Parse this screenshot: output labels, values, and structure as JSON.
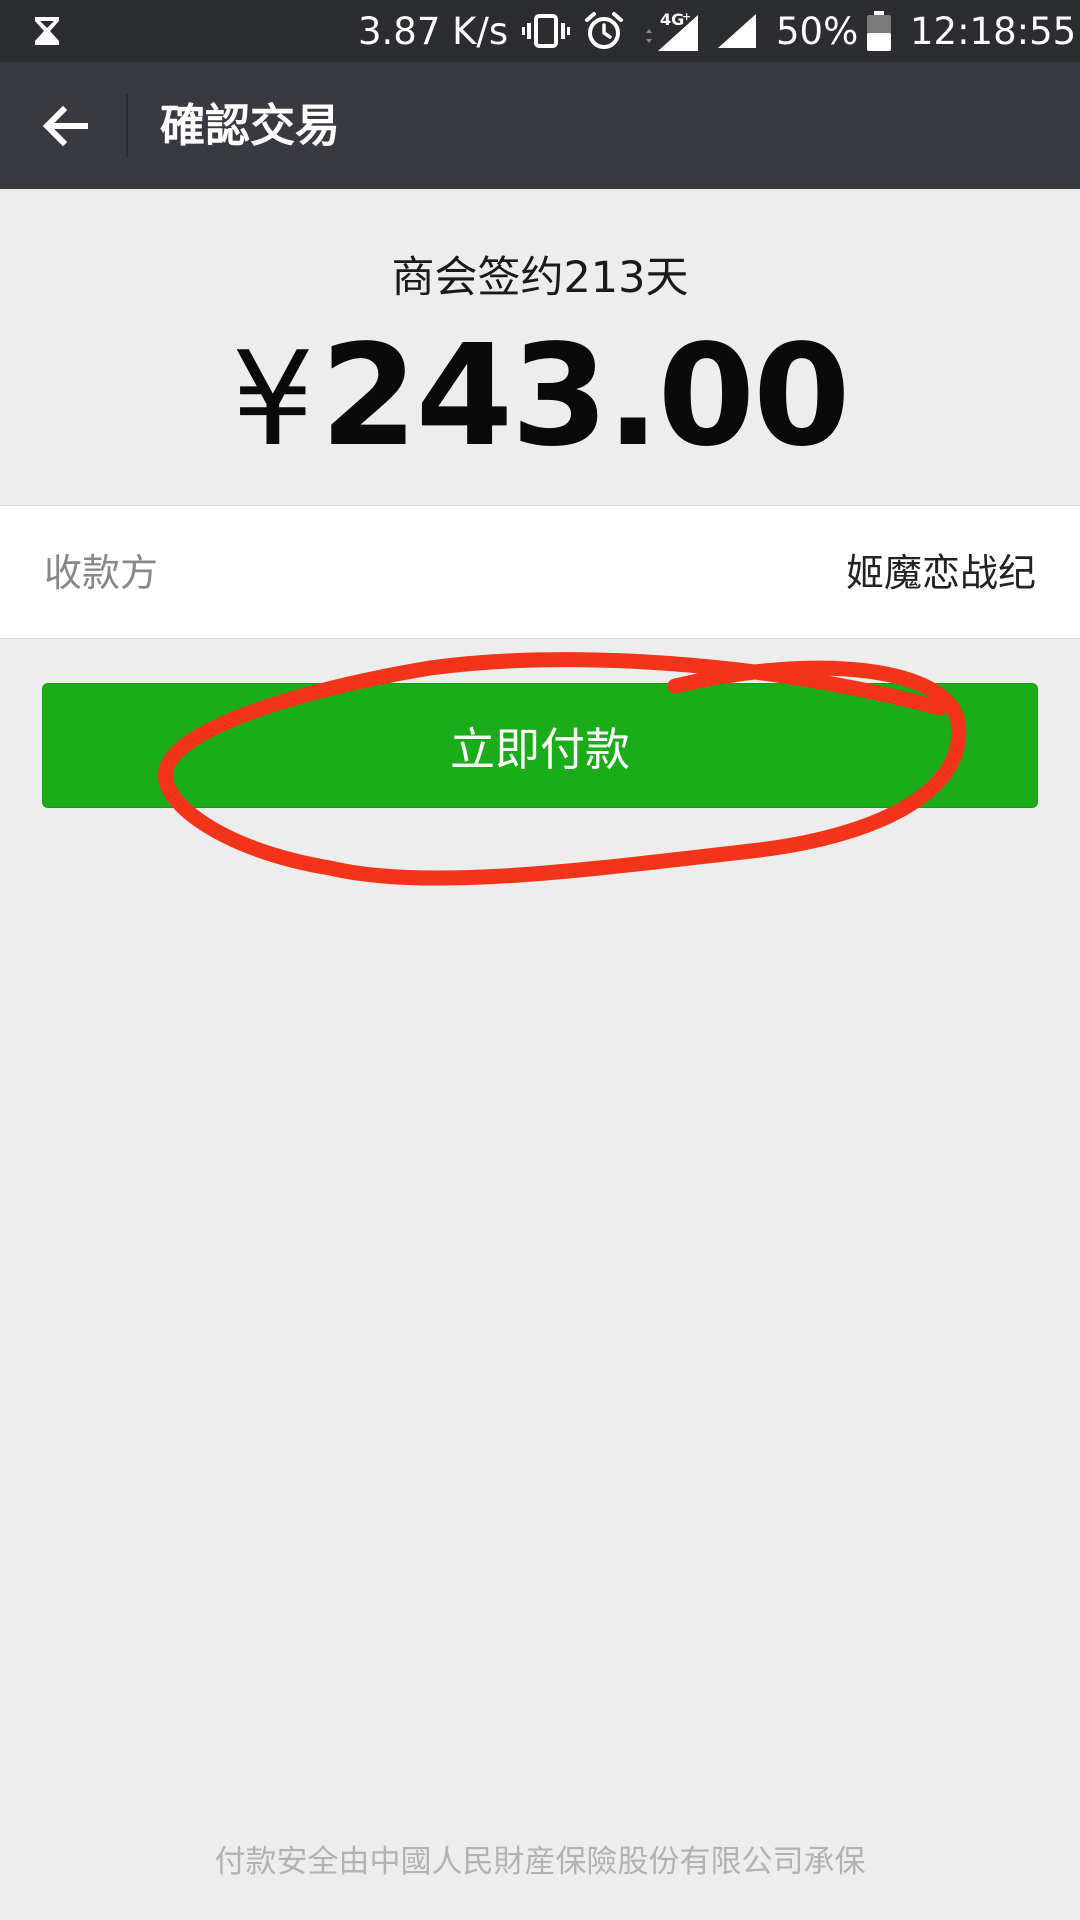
{
  "status_bar": {
    "net_speed": "3.87 K/s",
    "network": "4G",
    "battery": "50%",
    "time": "12:18:55"
  },
  "title_bar": {
    "title": "確認交易"
  },
  "order": {
    "product_name": "商会签约213天",
    "currency_symbol": "¥",
    "amount": "243.00"
  },
  "payee": {
    "label": "收款方",
    "value": "姬魔恋战纪"
  },
  "actions": {
    "pay_now": "立即付款"
  },
  "footer": {
    "insurance_note": "付款安全由中國人民財産保險股份有限公司承保"
  },
  "colors": {
    "status_bar": "#2c2d30",
    "title_bar": "#393a3f",
    "background": "#ededed",
    "pay_button": "#1aad19",
    "annotation_circle": "#f4341a"
  }
}
